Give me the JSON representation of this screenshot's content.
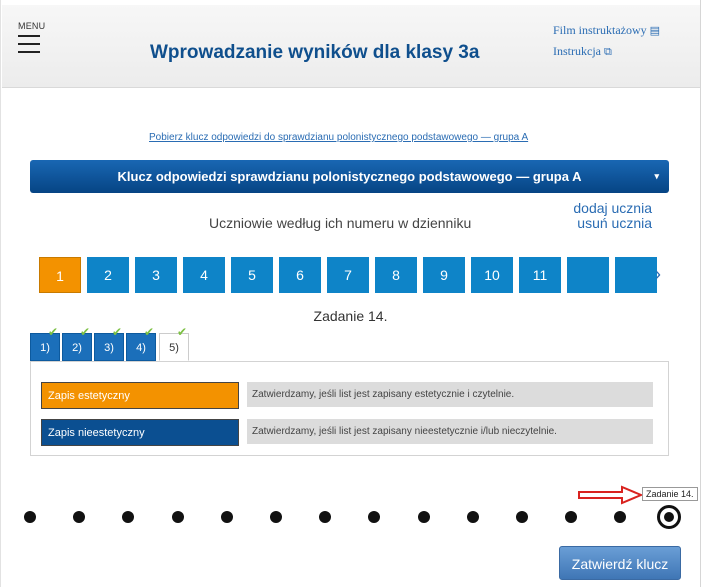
{
  "header": {
    "menu_label": "MENU",
    "title": "Wprowadzanie wyników dla klasy 3a",
    "film_link": "Film instruktażowy",
    "instr_link": "Instrukcja",
    "film_icon": "film-icon",
    "instr_icon": "external-window-icon"
  },
  "download_link": "Pobierz klucz odpowiedzi do sprawdzianu polonistycznego podstawowego — grupa A",
  "key_select": {
    "value": "Klucz odpowiedzi sprawdzianu polonistycznego podstawowego — grupa A",
    "caret": "▾"
  },
  "students": {
    "label": "Uczniowie według ich numeru w dzienniku",
    "add": "dodaj ucznia",
    "remove": "usuń ucznia",
    "numbers": [
      "1",
      "2",
      "3",
      "4",
      "5",
      "6",
      "7",
      "8",
      "9",
      "10",
      "11",
      "",
      ""
    ],
    "active_index": 0,
    "next": "›"
  },
  "task": {
    "label": "Zadanie 14.",
    "subtabs": [
      {
        "label": "1)",
        "done": true
      },
      {
        "label": "2)",
        "done": true
      },
      {
        "label": "3)",
        "done": true
      },
      {
        "label": "4)",
        "done": true
      },
      {
        "label": "5)",
        "done": true,
        "current": true
      }
    ],
    "check": "✔",
    "criteria": [
      {
        "button": "Zapis estetyczny",
        "description": "Zatwierdzamy, jeśli list jest zapisany estetycznie i czytelnie."
      },
      {
        "button": "Zapis nieestetyczny",
        "description": "Zatwierdzamy, jeśli list jest zapisany nieestetycznie i/lub nieczytelnie."
      }
    ]
  },
  "pager": {
    "dot_count": 14,
    "current_index": 13,
    "tooltip": "Zadanie 14."
  },
  "confirm_button": "Zatwierdź klucz",
  "colors": {
    "primary": "#0e84c8",
    "active": "#f39200",
    "dark_blue": "#0b4f91",
    "check": "#7cc043",
    "annotation_arrow": "#d9231f"
  }
}
